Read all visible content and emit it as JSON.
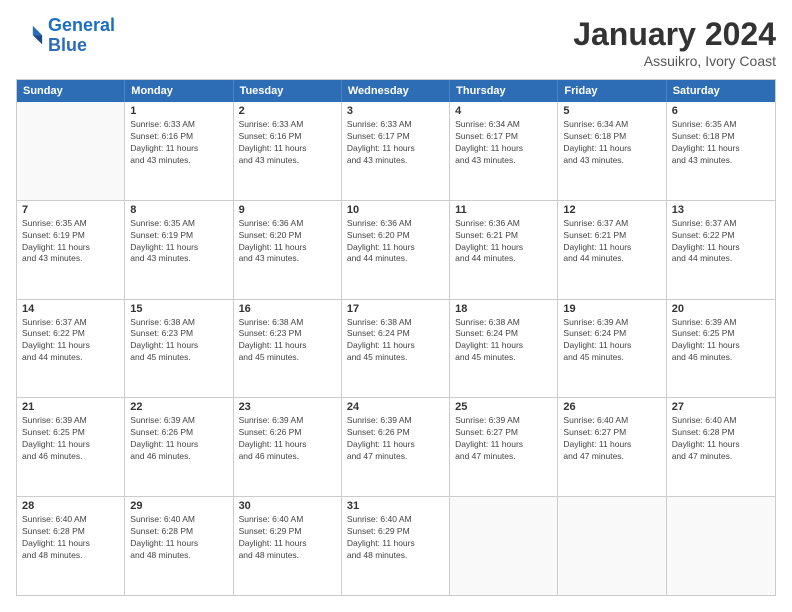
{
  "header": {
    "logo_line1": "General",
    "logo_line2": "Blue",
    "month": "January 2024",
    "location": "Assuikro, Ivory Coast"
  },
  "weekdays": [
    "Sunday",
    "Monday",
    "Tuesday",
    "Wednesday",
    "Thursday",
    "Friday",
    "Saturday"
  ],
  "rows": [
    [
      {
        "day": "",
        "lines": [],
        "empty": true
      },
      {
        "day": "1",
        "lines": [
          "Sunrise: 6:33 AM",
          "Sunset: 6:16 PM",
          "Daylight: 11 hours",
          "and 43 minutes."
        ]
      },
      {
        "day": "2",
        "lines": [
          "Sunrise: 6:33 AM",
          "Sunset: 6:16 PM",
          "Daylight: 11 hours",
          "and 43 minutes."
        ]
      },
      {
        "day": "3",
        "lines": [
          "Sunrise: 6:33 AM",
          "Sunset: 6:17 PM",
          "Daylight: 11 hours",
          "and 43 minutes."
        ]
      },
      {
        "day": "4",
        "lines": [
          "Sunrise: 6:34 AM",
          "Sunset: 6:17 PM",
          "Daylight: 11 hours",
          "and 43 minutes."
        ]
      },
      {
        "day": "5",
        "lines": [
          "Sunrise: 6:34 AM",
          "Sunset: 6:18 PM",
          "Daylight: 11 hours",
          "and 43 minutes."
        ]
      },
      {
        "day": "6",
        "lines": [
          "Sunrise: 6:35 AM",
          "Sunset: 6:18 PM",
          "Daylight: 11 hours",
          "and 43 minutes."
        ]
      }
    ],
    [
      {
        "day": "7",
        "lines": [
          "Sunrise: 6:35 AM",
          "Sunset: 6:19 PM",
          "Daylight: 11 hours",
          "and 43 minutes."
        ]
      },
      {
        "day": "8",
        "lines": [
          "Sunrise: 6:35 AM",
          "Sunset: 6:19 PM",
          "Daylight: 11 hours",
          "and 43 minutes."
        ]
      },
      {
        "day": "9",
        "lines": [
          "Sunrise: 6:36 AM",
          "Sunset: 6:20 PM",
          "Daylight: 11 hours",
          "and 43 minutes."
        ]
      },
      {
        "day": "10",
        "lines": [
          "Sunrise: 6:36 AM",
          "Sunset: 6:20 PM",
          "Daylight: 11 hours",
          "and 44 minutes."
        ]
      },
      {
        "day": "11",
        "lines": [
          "Sunrise: 6:36 AM",
          "Sunset: 6:21 PM",
          "Daylight: 11 hours",
          "and 44 minutes."
        ]
      },
      {
        "day": "12",
        "lines": [
          "Sunrise: 6:37 AM",
          "Sunset: 6:21 PM",
          "Daylight: 11 hours",
          "and 44 minutes."
        ]
      },
      {
        "day": "13",
        "lines": [
          "Sunrise: 6:37 AM",
          "Sunset: 6:22 PM",
          "Daylight: 11 hours",
          "and 44 minutes."
        ]
      }
    ],
    [
      {
        "day": "14",
        "lines": [
          "Sunrise: 6:37 AM",
          "Sunset: 6:22 PM",
          "Daylight: 11 hours",
          "and 44 minutes."
        ]
      },
      {
        "day": "15",
        "lines": [
          "Sunrise: 6:38 AM",
          "Sunset: 6:23 PM",
          "Daylight: 11 hours",
          "and 45 minutes."
        ]
      },
      {
        "day": "16",
        "lines": [
          "Sunrise: 6:38 AM",
          "Sunset: 6:23 PM",
          "Daylight: 11 hours",
          "and 45 minutes."
        ]
      },
      {
        "day": "17",
        "lines": [
          "Sunrise: 6:38 AM",
          "Sunset: 6:24 PM",
          "Daylight: 11 hours",
          "and 45 minutes."
        ]
      },
      {
        "day": "18",
        "lines": [
          "Sunrise: 6:38 AM",
          "Sunset: 6:24 PM",
          "Daylight: 11 hours",
          "and 45 minutes."
        ]
      },
      {
        "day": "19",
        "lines": [
          "Sunrise: 6:39 AM",
          "Sunset: 6:24 PM",
          "Daylight: 11 hours",
          "and 45 minutes."
        ]
      },
      {
        "day": "20",
        "lines": [
          "Sunrise: 6:39 AM",
          "Sunset: 6:25 PM",
          "Daylight: 11 hours",
          "and 46 minutes."
        ]
      }
    ],
    [
      {
        "day": "21",
        "lines": [
          "Sunrise: 6:39 AM",
          "Sunset: 6:25 PM",
          "Daylight: 11 hours",
          "and 46 minutes."
        ]
      },
      {
        "day": "22",
        "lines": [
          "Sunrise: 6:39 AM",
          "Sunset: 6:26 PM",
          "Daylight: 11 hours",
          "and 46 minutes."
        ]
      },
      {
        "day": "23",
        "lines": [
          "Sunrise: 6:39 AM",
          "Sunset: 6:26 PM",
          "Daylight: 11 hours",
          "and 46 minutes."
        ]
      },
      {
        "day": "24",
        "lines": [
          "Sunrise: 6:39 AM",
          "Sunset: 6:26 PM",
          "Daylight: 11 hours",
          "and 47 minutes."
        ]
      },
      {
        "day": "25",
        "lines": [
          "Sunrise: 6:39 AM",
          "Sunset: 6:27 PM",
          "Daylight: 11 hours",
          "and 47 minutes."
        ]
      },
      {
        "day": "26",
        "lines": [
          "Sunrise: 6:40 AM",
          "Sunset: 6:27 PM",
          "Daylight: 11 hours",
          "and 47 minutes."
        ]
      },
      {
        "day": "27",
        "lines": [
          "Sunrise: 6:40 AM",
          "Sunset: 6:28 PM",
          "Daylight: 11 hours",
          "and 47 minutes."
        ]
      }
    ],
    [
      {
        "day": "28",
        "lines": [
          "Sunrise: 6:40 AM",
          "Sunset: 6:28 PM",
          "Daylight: 11 hours",
          "and 48 minutes."
        ]
      },
      {
        "day": "29",
        "lines": [
          "Sunrise: 6:40 AM",
          "Sunset: 6:28 PM",
          "Daylight: 11 hours",
          "and 48 minutes."
        ]
      },
      {
        "day": "30",
        "lines": [
          "Sunrise: 6:40 AM",
          "Sunset: 6:29 PM",
          "Daylight: 11 hours",
          "and 48 minutes."
        ]
      },
      {
        "day": "31",
        "lines": [
          "Sunrise: 6:40 AM",
          "Sunset: 6:29 PM",
          "Daylight: 11 hours",
          "and 48 minutes."
        ]
      },
      {
        "day": "",
        "lines": [],
        "empty": true
      },
      {
        "day": "",
        "lines": [],
        "empty": true
      },
      {
        "day": "",
        "lines": [],
        "empty": true
      }
    ]
  ]
}
